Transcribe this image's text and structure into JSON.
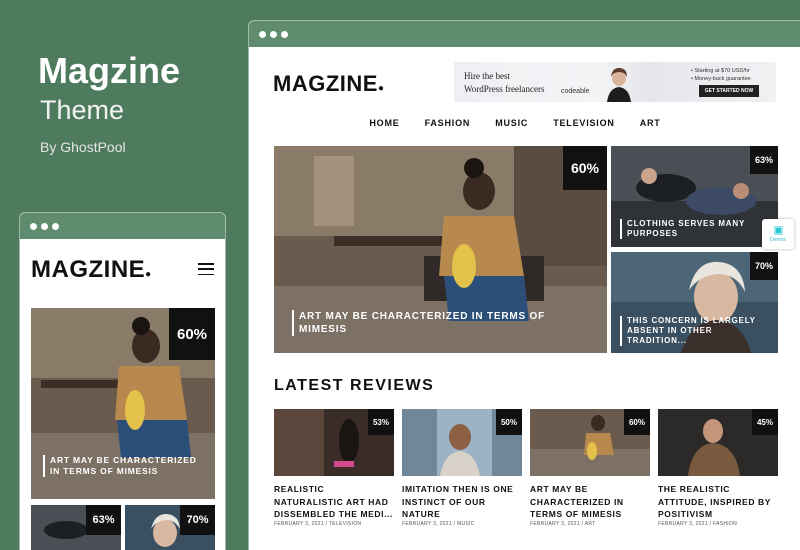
{
  "promo": {
    "title": "Magzine",
    "subtitle": "Theme",
    "by": "By GhostPool"
  },
  "desktop": {
    "logo": "MAGZINE",
    "logo_dot": "●",
    "ad": {
      "line1": "Hire the best",
      "line2": "WordPress freelancers",
      "brand": "codeable",
      "bullet1": "• Starting at $70 USD/hr",
      "bullet2": "• Money-back guarantee",
      "cta": "GET STARTED NOW"
    },
    "nav": [
      "HOME",
      "FASHION",
      "MUSIC",
      "TELEVISION",
      "ART"
    ],
    "hero": {
      "badge": "60%",
      "title": "ART MAY BE CHARACTERIZED IN TERMS OF MIMESIS"
    },
    "side1": {
      "badge": "63%",
      "title": "CLOTHING SERVES MANY PURPOSES"
    },
    "side2": {
      "badge": "70%",
      "title": "THIS CONCERN IS LARGELY ABSENT IN OTHER TRADITION..."
    },
    "demo_label": "Demos",
    "section_title": "LATEST REVIEWS",
    "reviews": [
      {
        "badge": "53%",
        "title": "REALISTIC NATURALISTIC ART HAD DISSEMBLED THE MEDI...",
        "meta": "FEBRUARY 3, 2021 / TELEVISION"
      },
      {
        "badge": "50%",
        "title": "IMITATION THEN IS ONE INSTINCT OF OUR NATURE",
        "meta": "FEBRUARY 3, 2021 / MUSIC"
      },
      {
        "badge": "60%",
        "title": "ART MAY BE CHARACTERIZED IN TERMS OF MIMESIS",
        "meta": "FEBRUARY 3, 2021 / ART"
      },
      {
        "badge": "45%",
        "title": "THE REALISTIC ATTITUDE, INSPIRED BY POSITIVISM",
        "meta": "FEBRUARY 3, 2021 / FASHION"
      }
    ]
  },
  "mobile": {
    "logo": "MAGZINE",
    "logo_dot": "●",
    "hero": {
      "badge": "60%",
      "title": "ART MAY BE CHARACTERIZED IN TERMS OF MIMESIS"
    },
    "thumb1": {
      "badge": "63%"
    },
    "thumb2": {
      "badge": "70%"
    }
  },
  "colors": {
    "background": "#4e7a5e",
    "window_bar": "#5f8b6e",
    "badge": "#111111",
    "accent": "#2fc9d6"
  }
}
